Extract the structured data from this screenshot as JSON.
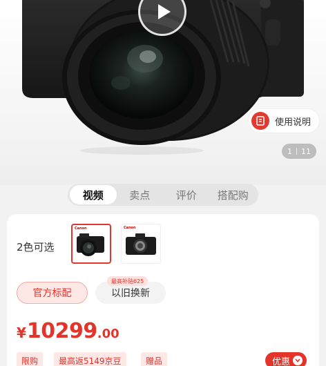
{
  "hero": {
    "image": "camera-product-photo",
    "play_icon": "play-icon",
    "manual_icon": "manual-icon",
    "manual_label": "使用说明",
    "pager": {
      "current": "1",
      "total": "11"
    }
  },
  "tabs": [
    {
      "label": "视频",
      "active": true
    },
    {
      "label": "卖点",
      "active": false
    },
    {
      "label": "评价",
      "active": false
    },
    {
      "label": "搭配购",
      "active": false
    }
  ],
  "product": {
    "color_label": "2色可选",
    "thumbnails": [
      {
        "name": "camera-with-lens",
        "brand": "Canon",
        "selected": true
      },
      {
        "name": "camera-body-only",
        "brand": "Canon",
        "selected": false
      }
    ],
    "options": {
      "official_label": "官方标配",
      "tradein_label": "以旧换新",
      "tradein_badge": "最高补贴625"
    },
    "price": {
      "symbol": "¥",
      "integer": "10299",
      "decimal": ".00"
    },
    "tags": [
      "限购",
      "最高返5149京豆",
      "赠品"
    ],
    "coupon_label": "优惠",
    "accent_color": "#e3342c"
  }
}
